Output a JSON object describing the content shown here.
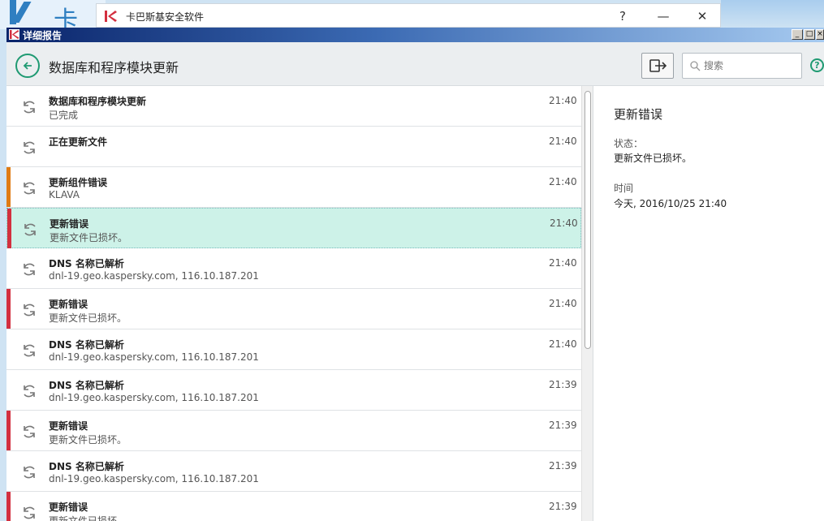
{
  "background": {
    "logo_text": "卡"
  },
  "parent_window": {
    "title": "卡巴斯基安全软件",
    "help": "?",
    "minimize": "—",
    "close": "✕"
  },
  "window": {
    "title": "详细报告"
  },
  "header": {
    "title": "数据库和程序模块更新",
    "search_placeholder": "搜索",
    "help": "?"
  },
  "events": [
    {
      "title": "数据库和程序模块更新",
      "subtitle": "已完成",
      "time": "21:40",
      "marker": "none"
    },
    {
      "title": "正在更新文件",
      "subtitle": "",
      "time": "21:40",
      "marker": "none"
    },
    {
      "title": "更新组件错误",
      "subtitle": "KLAVA",
      "time": "21:40",
      "marker": "#e07b13"
    },
    {
      "title": "更新错误",
      "subtitle": "更新文件已损坏。",
      "time": "21:40",
      "marker": "#d32f3f",
      "selected": true
    },
    {
      "title": "DNS 名称已解析",
      "subtitle": "dnl-19.geo.kaspersky.com, 116.10.187.201",
      "time": "21:40",
      "marker": "none"
    },
    {
      "title": "更新错误",
      "subtitle": "更新文件已损坏。",
      "time": "21:40",
      "marker": "#d32f3f"
    },
    {
      "title": "DNS 名称已解析",
      "subtitle": "dnl-19.geo.kaspersky.com, 116.10.187.201",
      "time": "21:40",
      "marker": "none"
    },
    {
      "title": "DNS 名称已解析",
      "subtitle": "dnl-19.geo.kaspersky.com, 116.10.187.201",
      "time": "21:39",
      "marker": "none"
    },
    {
      "title": "更新错误",
      "subtitle": "更新文件已损坏。",
      "time": "21:39",
      "marker": "#d32f3f"
    },
    {
      "title": "DNS 名称已解析",
      "subtitle": "dnl-19.geo.kaspersky.com, 116.10.187.201",
      "time": "21:39",
      "marker": "none"
    },
    {
      "title": "更新错误",
      "subtitle": "更新文件已损坏。",
      "time": "21:39",
      "marker": "#d32f3f"
    }
  ],
  "detail": {
    "title": "更新错误",
    "status_label": "状态：",
    "status_value": "更新文件已损坏。",
    "time_label": "时间",
    "time_value": "今天, 2016/10/25 21:40"
  },
  "colors": {
    "accent": "#1f9a72",
    "selected_row": "#cdf2e8",
    "error_marker": "#d32f3f",
    "warning_marker": "#e07b13"
  },
  "icons": {
    "row": "refresh-icon",
    "back": "back-arrow-icon",
    "export": "export-icon",
    "search": "search-icon",
    "help": "help-icon"
  }
}
